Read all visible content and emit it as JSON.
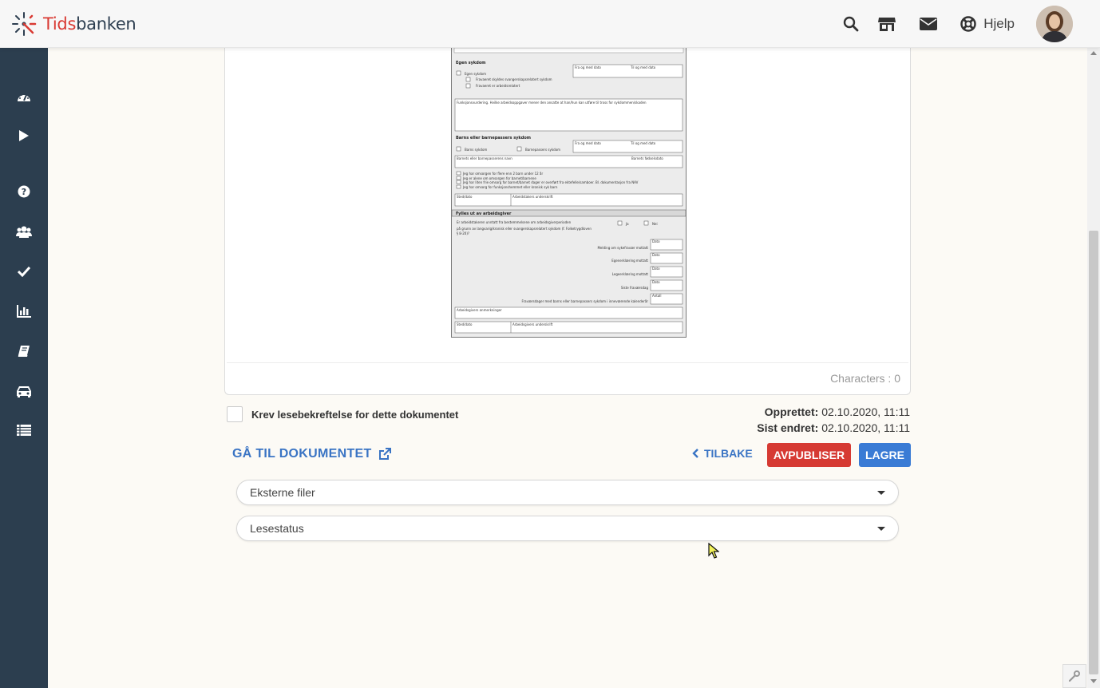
{
  "brand": {
    "name_part1": "Tids",
    "name_part2": "banken"
  },
  "header": {
    "help_label": "Hjelp"
  },
  "sidebar": {
    "items": [
      {
        "icon": "dashboard-icon"
      },
      {
        "icon": "play-icon"
      },
      {
        "icon": "question-icon"
      },
      {
        "icon": "users-icon"
      },
      {
        "icon": "check-icon"
      },
      {
        "icon": "bar-chart-icon"
      },
      {
        "icon": "book-icon"
      },
      {
        "icon": "car-icon"
      },
      {
        "icon": "list-icon"
      }
    ]
  },
  "document": {
    "characters_label": "Characters : 0"
  },
  "form": {
    "read_confirm_label": "Krev lesebekreftelse for dette dokumentet",
    "created_label": "Opprettet:",
    "created_value": "02.10.2020, 11:11",
    "modified_label": "Sist endret:",
    "modified_value": "02.10.2020, 11:11",
    "goto_label": "GÅ TIL DOKUMENTET",
    "back_label": "TILBAKE",
    "unpublish_label": "AVPUBLISER",
    "save_label": "LAGRE"
  },
  "panels": [
    {
      "label": "Eksterne filer"
    },
    {
      "label": "Lesestatus"
    }
  ],
  "colors": {
    "sidebar": "#2c3e4f",
    "primary": "#3a7bd5",
    "danger": "#d63a33",
    "link": "#3a74c4"
  }
}
